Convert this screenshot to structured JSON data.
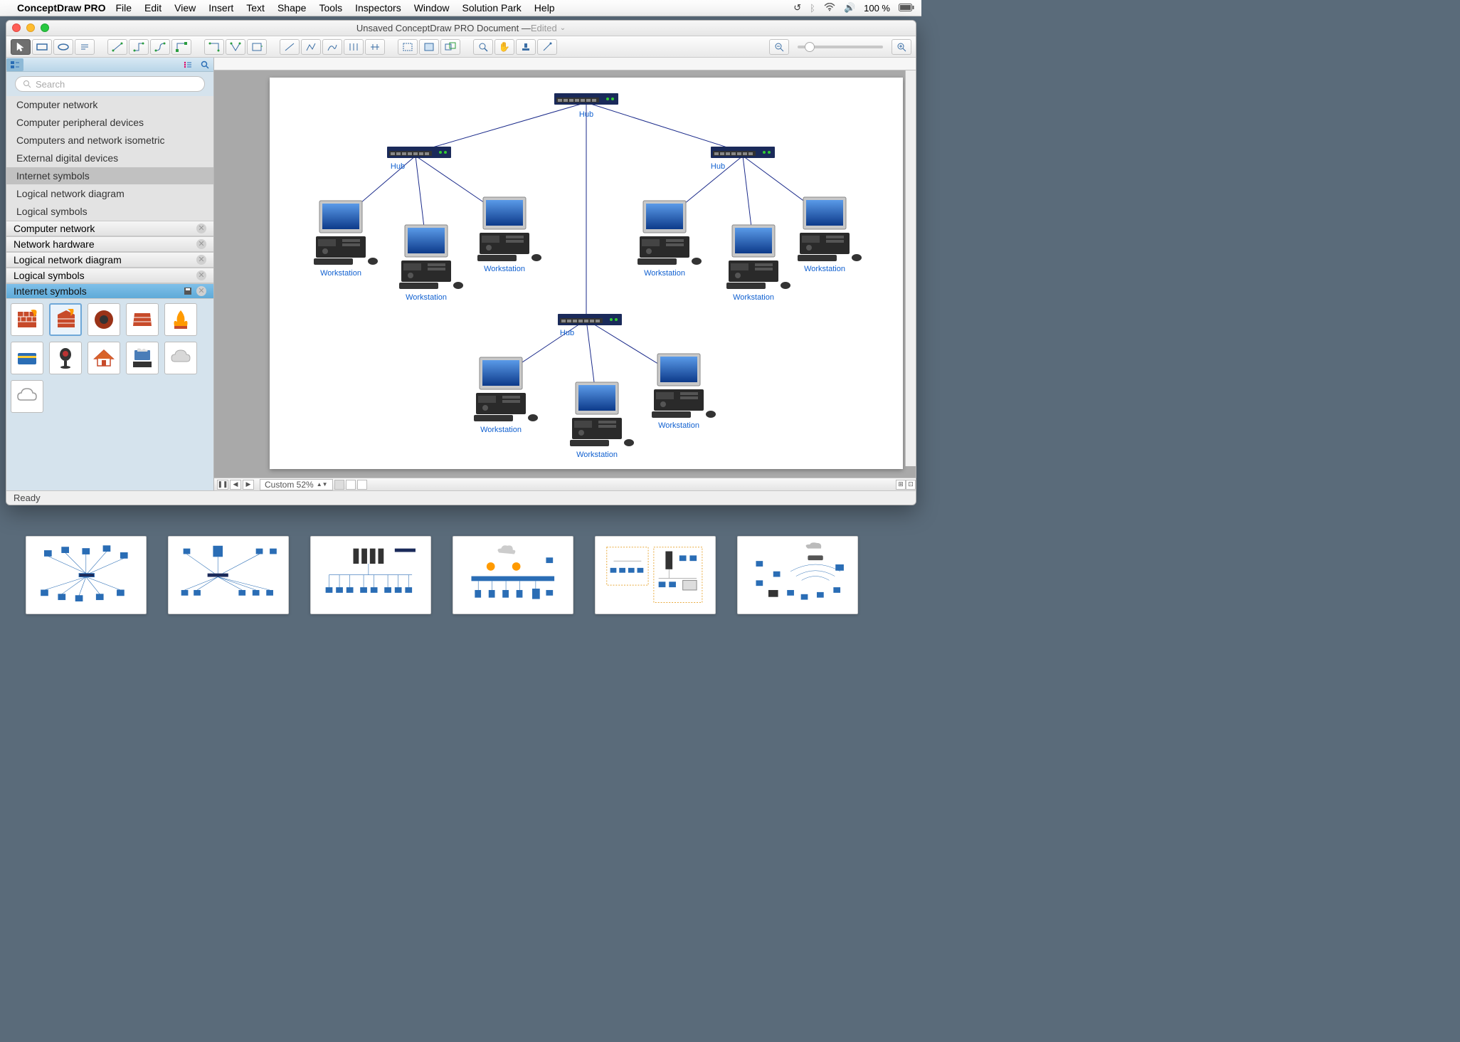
{
  "menubar": {
    "app_name": "ConceptDraw PRO",
    "items": [
      "File",
      "Edit",
      "View",
      "Insert",
      "Text",
      "Shape",
      "Tools",
      "Inspectors",
      "Window",
      "Solution Park",
      "Help"
    ],
    "battery": "100 %"
  },
  "window": {
    "title_main": "Unsaved ConceptDraw PRO Document — ",
    "title_sub": "Edited"
  },
  "sidebar": {
    "search_placeholder": "Search",
    "library_categories": [
      "Computer network",
      "Computer peripheral devices",
      "Computers and network isometric",
      "External digital devices",
      "Internet symbols",
      "Logical network diagram",
      "Logical symbols",
      "Network hardware"
    ],
    "selected_category_index": 4,
    "open_libraries": [
      "Computer network",
      "Network hardware",
      "Logical network diagram",
      "Logical symbols",
      "Internet symbols"
    ],
    "active_open_index": 4,
    "shape_icons": [
      "firewall-1",
      "firewall-2",
      "firewall-round",
      "firewall-3",
      "firewall-flame",
      "card",
      "webcam",
      "home",
      "server",
      "cloud",
      "cloud-outline"
    ]
  },
  "canvas": {
    "nodes": {
      "hub_top": {
        "label": "Hub"
      },
      "hub_left": {
        "label": "Hub"
      },
      "hub_right": {
        "label": "Hub"
      },
      "hub_bottom": {
        "label": "Hub"
      },
      "ws": {
        "label": "Workstation"
      }
    }
  },
  "footer": {
    "zoom_label": "Custom 52%"
  },
  "status": {
    "text": "Ready"
  },
  "thumbs": [
    "template-1",
    "template-2",
    "template-3",
    "template-4",
    "template-5",
    "template-6"
  ]
}
